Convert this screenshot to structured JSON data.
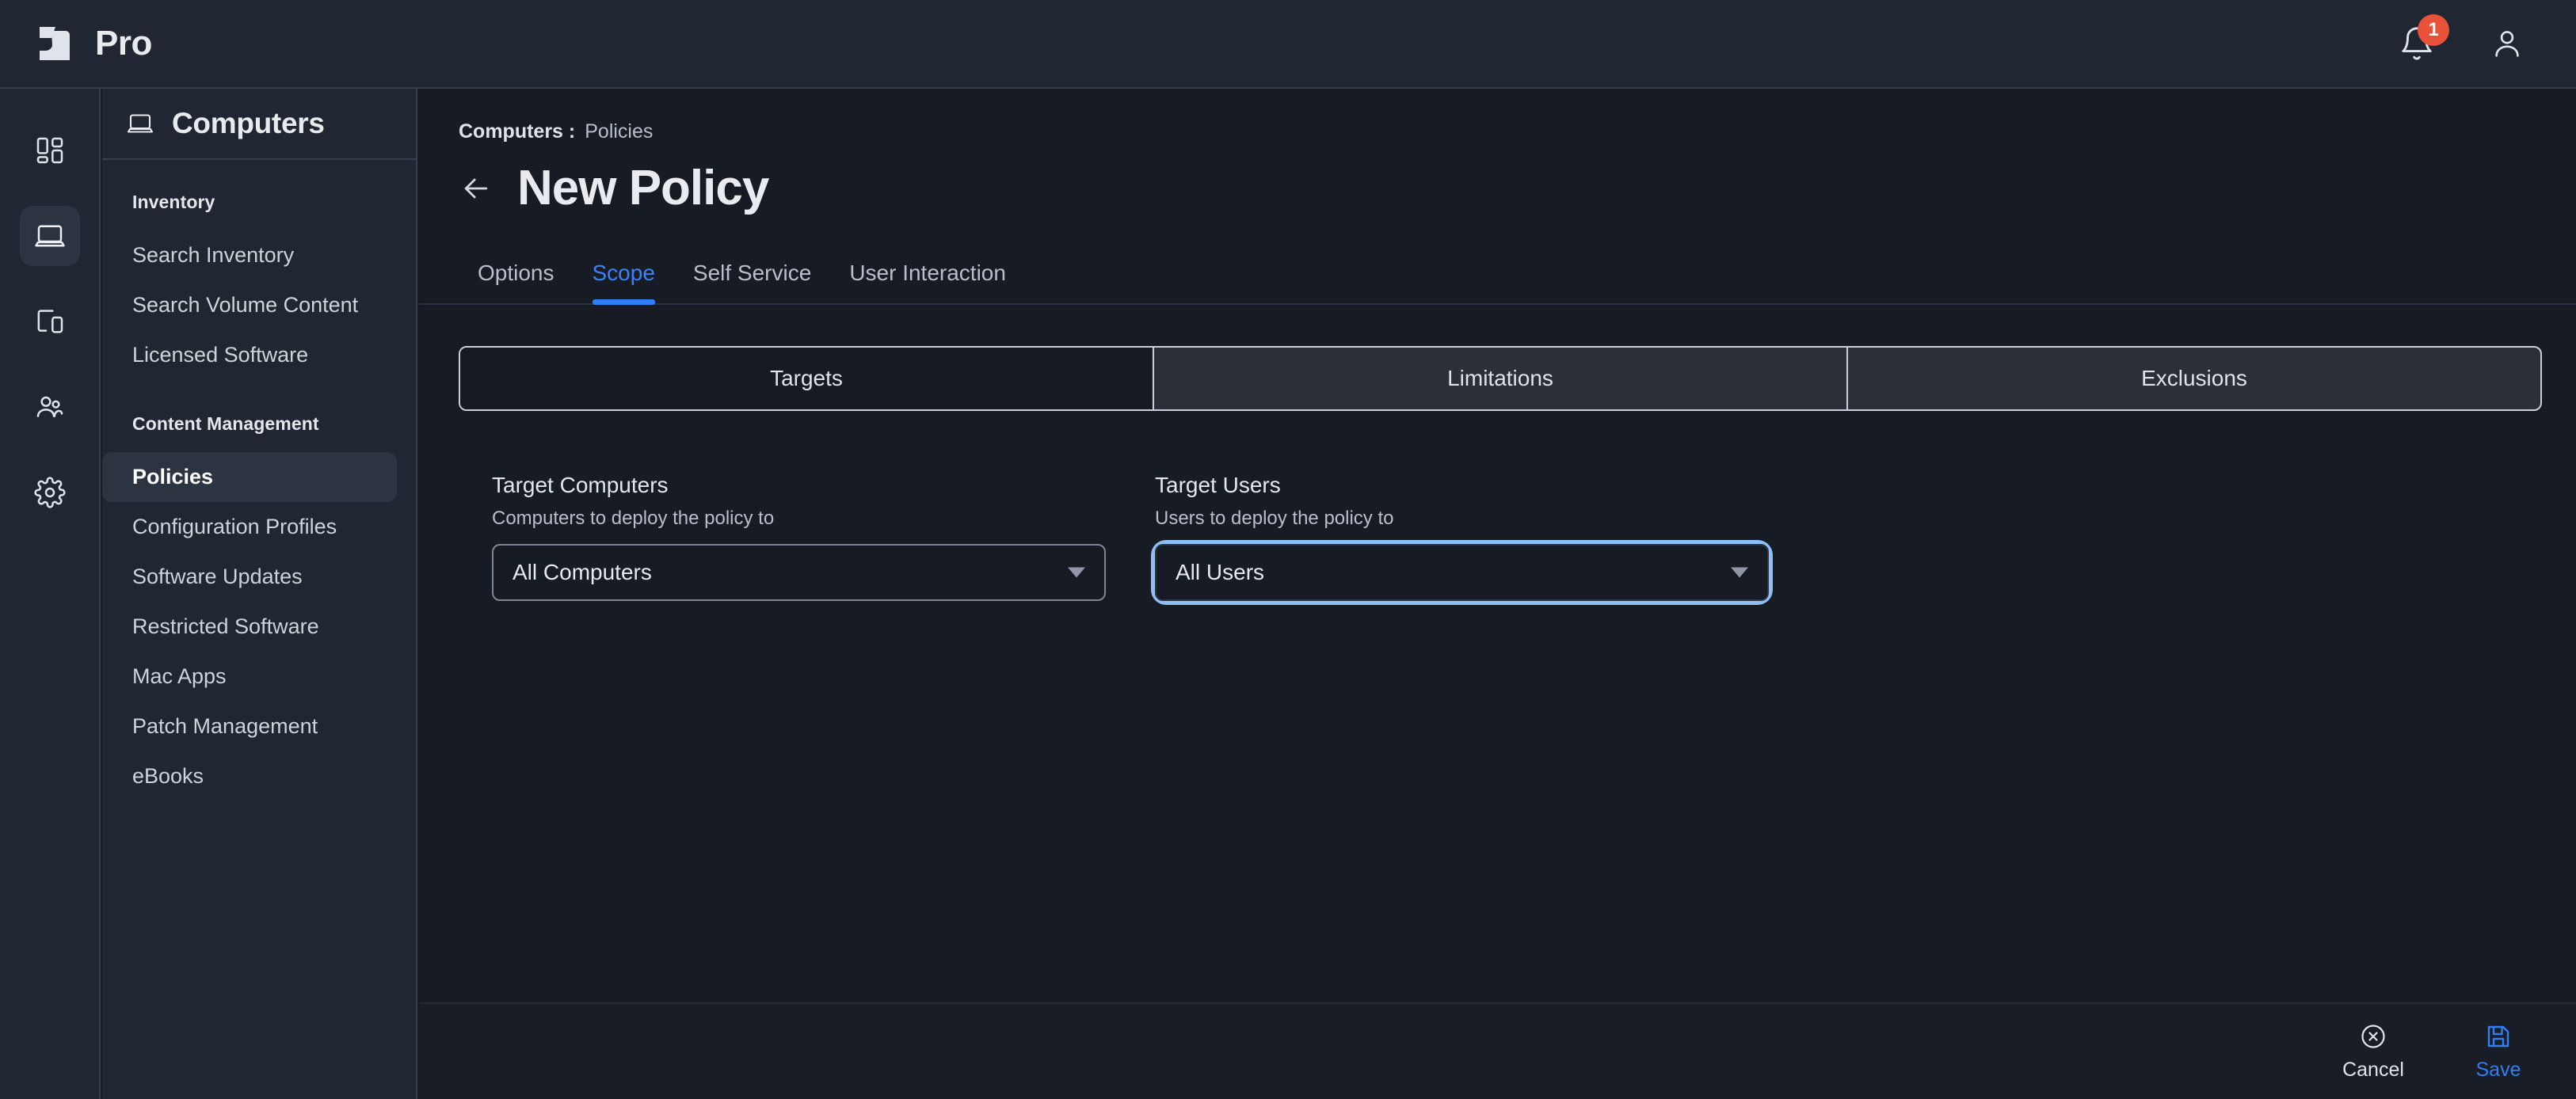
{
  "topbar": {
    "brand_name": "Pro",
    "logo_icon": "jamf-logo-icon",
    "notifications_icon": "bell-icon",
    "notifications_count": "1",
    "account_icon": "user-account-icon",
    "badge_color": "#e8513a"
  },
  "rail": {
    "items": [
      {
        "icon": "dashboard-grid-icon",
        "name": "dashboard",
        "active": false
      },
      {
        "icon": "laptop-icon",
        "name": "computers",
        "active": true
      },
      {
        "icon": "mobile-devices-icon",
        "name": "mobile-devices",
        "active": false
      },
      {
        "icon": "users-icon",
        "name": "users",
        "active": false
      },
      {
        "icon": "gear-icon",
        "name": "settings",
        "active": false
      }
    ]
  },
  "sidebar": {
    "header_icon": "laptop-icon",
    "header_title": "Computers",
    "groups": [
      {
        "label": "Inventory",
        "items": [
          {
            "label": "Search Inventory",
            "active": false
          },
          {
            "label": "Search Volume Content",
            "active": false
          },
          {
            "label": "Licensed Software",
            "active": false
          }
        ]
      },
      {
        "label": "Content Management",
        "items": [
          {
            "label": "Policies",
            "active": true
          },
          {
            "label": "Configuration Profiles",
            "active": false
          },
          {
            "label": "Software Updates",
            "active": false
          },
          {
            "label": "Restricted Software",
            "active": false
          },
          {
            "label": "Mac Apps",
            "active": false
          },
          {
            "label": "Patch Management",
            "active": false
          },
          {
            "label": "eBooks",
            "active": false
          }
        ]
      }
    ]
  },
  "page": {
    "breadcrumb_current": "Computers :",
    "breadcrumb_link": "Policies",
    "back_icon": "arrow-left-icon",
    "title": "New Policy",
    "accent_color": "#2f7ef5"
  },
  "tabs": [
    {
      "label": "Options",
      "active": false
    },
    {
      "label": "Scope",
      "active": true
    },
    {
      "label": "Self Service",
      "active": false
    },
    {
      "label": "User Interaction",
      "active": false
    }
  ],
  "segmented": [
    {
      "label": "Targets",
      "active": true
    },
    {
      "label": "Limitations",
      "active": false
    },
    {
      "label": "Exclusions",
      "active": false
    }
  ],
  "fields": {
    "target_computers": {
      "label": "Target Computers",
      "hint": "Computers to deploy the policy to",
      "value": "All Computers",
      "caret_icon": "chevron-down-icon",
      "focused": false
    },
    "target_users": {
      "label": "Target Users",
      "hint": "Users to deploy the policy to",
      "value": "All Users",
      "caret_icon": "chevron-down-icon",
      "focused": true
    }
  },
  "footer": {
    "cancel_label": "Cancel",
    "cancel_icon": "close-circle-icon",
    "save_label": "Save",
    "save_icon": "floppy-disk-save-icon"
  }
}
